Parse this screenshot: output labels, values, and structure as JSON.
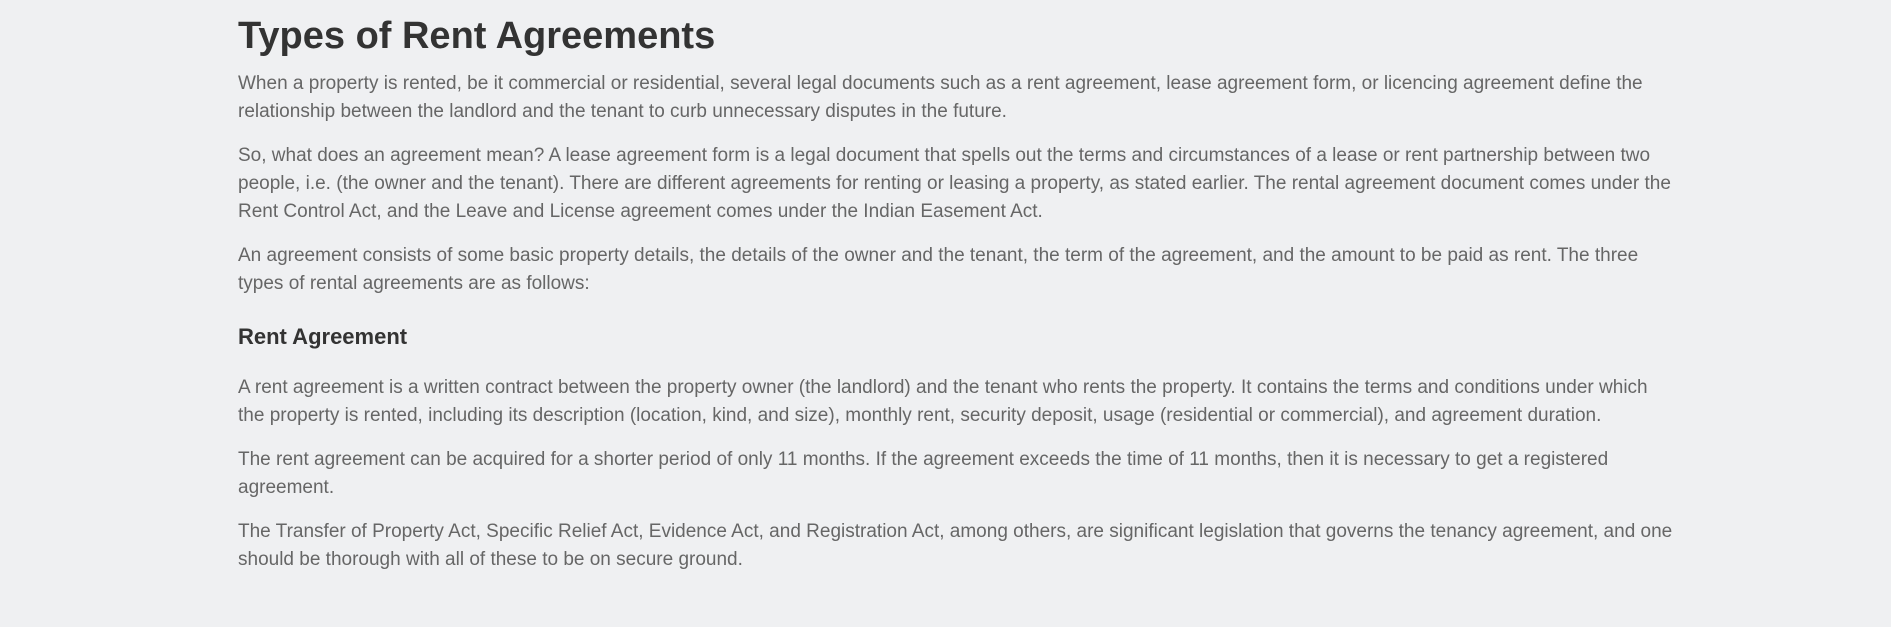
{
  "article": {
    "title": "Types of Rent Agreements",
    "paragraphs": [
      "When a property is rented, be it commercial or residential, several legal documents such as a rent agreement, lease agreement form, or licencing agreement define the relationship between the landlord and the tenant to curb unnecessary disputes in the future.",
      "So, what does an agreement mean? A lease agreement form is a legal document that spells out the terms and circumstances of a lease or rent partnership between two people, i.e. (the owner and the tenant). There are different agreements for renting or leasing a property, as stated earlier. The rental agreement document comes under the Rent Control Act, and the Leave and License agreement comes under the Indian Easement Act.",
      "An agreement consists of some basic property details, the details of the owner and the tenant, the term of the agreement, and the amount to be paid as rent. The three types of rental agreements are as follows:"
    ],
    "section": {
      "heading": "Rent Agreement",
      "paragraphs": [
        "A rent agreement is a written contract between the property owner (the landlord) and the tenant who rents the property. It contains the terms and conditions under which the property is rented, including its description (location, kind, and size), monthly rent, security deposit, usage (residential or commercial), and agreement duration.",
        "The rent agreement can be acquired for a shorter period of only 11 months. If the agreement exceeds the time of 11 months, then it is necessary to get a registered agreement.",
        "The Transfer of Property Act, Specific Relief Act, Evidence Act, and Registration Act, among others, are significant legislation that governs the tenancy agreement, and one should be thorough with all of these to be on secure ground."
      ]
    }
  }
}
